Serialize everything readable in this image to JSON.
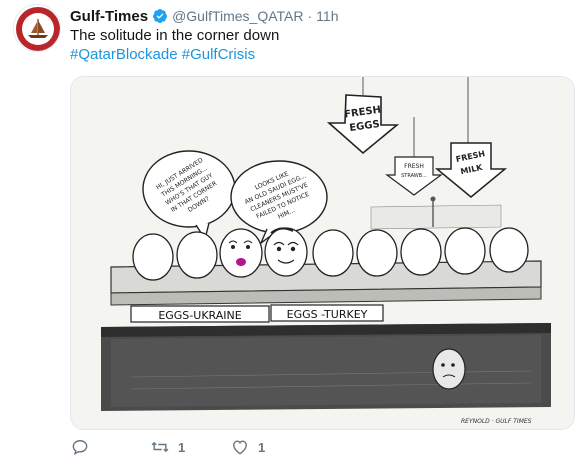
{
  "tweet": {
    "display_name": "Gulf-Times",
    "handle": "@GulfTimes_QATAR",
    "separator": "·",
    "time": "11h",
    "text": "The solitude in the corner down",
    "hashtags": [
      "#QatarBlockade",
      "#GulfCrisis"
    ]
  },
  "cartoon": {
    "signs": {
      "fresh_eggs": [
        "FRESH",
        "EGGS"
      ],
      "fresh_strawberry": [
        "FRESH",
        "STRAWB..."
      ],
      "fresh_milk": [
        "FRESH",
        "MILK"
      ]
    },
    "speech_left": [
      "HI, JUST ARRIVED",
      "THIS MORNING...",
      "WHO'S THAT GUY",
      "IN THAT CORNER",
      "DOWN?"
    ],
    "speech_right": [
      "LOOKS LIKE",
      "AN OLD SAUDI EGG...",
      "CLEANERS MUST'VE",
      "FAILED TO NOTICE",
      "HIM..."
    ],
    "label_left": "EGGS-UKRAINE",
    "label_right": "EGGS -TURKEY",
    "signature": "REYNOLD · GULF TIMES"
  },
  "actions": {
    "reply_count": "",
    "retweet_count": "1",
    "like_count": "1"
  },
  "colors": {
    "link": "#1b95e0",
    "verified": "#1da1f2",
    "muted": "#657786",
    "avatar_red": "#b8262c"
  }
}
